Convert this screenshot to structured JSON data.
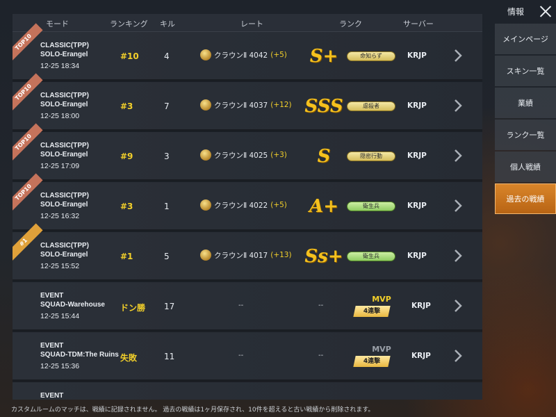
{
  "menu": {
    "title": "情報",
    "items": [
      {
        "label": "メインページ",
        "active": false
      },
      {
        "label": "スキン一覧",
        "active": false
      },
      {
        "label": "業績",
        "active": false
      },
      {
        "label": "ランク一覧",
        "active": false
      },
      {
        "label": "個人戦績",
        "active": false
      },
      {
        "label": "過去の戦績",
        "active": true
      }
    ]
  },
  "headers": {
    "mode": "モード",
    "ranking": "ランキング",
    "kills": "キル",
    "rate": "レート",
    "rank": "ランク",
    "server": "サーバー"
  },
  "rows": [
    {
      "ribbon": "TOP10",
      "mode1": "CLASSIC(TPP)",
      "mode2": "SOLO-Erangel",
      "time": "12-25 18:34",
      "ranking": "#10",
      "kills": "4",
      "rate": "クラウンⅡ 4042",
      "delta": "(+5)",
      "grade": "S+",
      "title": "命知らず",
      "title_color": "gold",
      "server": "KRJP"
    },
    {
      "ribbon": "TOP10",
      "mode1": "CLASSIC(TPP)",
      "mode2": "SOLO-Erangel",
      "time": "12-25 18:00",
      "ranking": "#3",
      "kills": "7",
      "rate": "クラウンⅡ 4037",
      "delta": "(+12)",
      "grade": "SSS",
      "title": "虐殺者",
      "title_color": "gold",
      "server": "KRJP"
    },
    {
      "ribbon": "TOP10",
      "mode1": "CLASSIC(TPP)",
      "mode2": "SOLO-Erangel",
      "time": "12-25 17:09",
      "ranking": "#9",
      "kills": "3",
      "rate": "クラウンⅡ 4025",
      "delta": "(+3)",
      "grade": "S",
      "title": "隠密行動",
      "title_color": "gold",
      "server": "KRJP"
    },
    {
      "ribbon": "TOP10",
      "mode1": "CLASSIC(TPP)",
      "mode2": "SOLO-Erangel",
      "time": "12-25 16:32",
      "ranking": "#3",
      "kills": "1",
      "rate": "クラウンⅡ 4022",
      "delta": "(+5)",
      "grade": "A+",
      "title": "衛生兵",
      "title_color": "green",
      "server": "KRJP"
    },
    {
      "ribbon": "#1",
      "mode1": "CLASSIC(TPP)",
      "mode2": "SOLO-Erangel",
      "time": "12-25 15:52",
      "ranking": "#1",
      "kills": "5",
      "rate": "クラウンⅡ 4017",
      "delta": "(+13)",
      "grade": "Ss+",
      "title": "衛生兵",
      "title_color": "green",
      "server": "KRJP"
    },
    {
      "ribbon": "",
      "mode1": "EVENT",
      "mode2": "SQUAD-Warehouse",
      "time": "12-25 15:44",
      "ranking": "ドン勝",
      "kills": "17",
      "rate": "--",
      "delta": "",
      "grade": "--",
      "mvp": "MVP",
      "streak": "4連撃",
      "server": "KRJP"
    },
    {
      "ribbon": "",
      "mode1": "EVENT",
      "mode2": "SQUAD-TDM:The Ruins",
      "time": "12-25 15:36",
      "ranking": "失敗",
      "kills": "11",
      "rate": "--",
      "delta": "",
      "grade": "--",
      "mvp": "MVP",
      "mvp_grey": true,
      "streak": "4連撃",
      "server": "KRJP"
    },
    {
      "ribbon": "",
      "mode1": "EVENT",
      "mode2": "",
      "time": "",
      "ranking": "",
      "kills": "",
      "rate": "",
      "delta": "",
      "grade": "",
      "server": ""
    }
  ],
  "footnote": "カスタムルームのマッチは、戦績に記録されません。 過去の戦績は1ヶ月保存され、10件を超えると古い戦績から削除されます。",
  "colors": {
    "accent": "#d9852a",
    "gold": "#f2cf2a"
  }
}
